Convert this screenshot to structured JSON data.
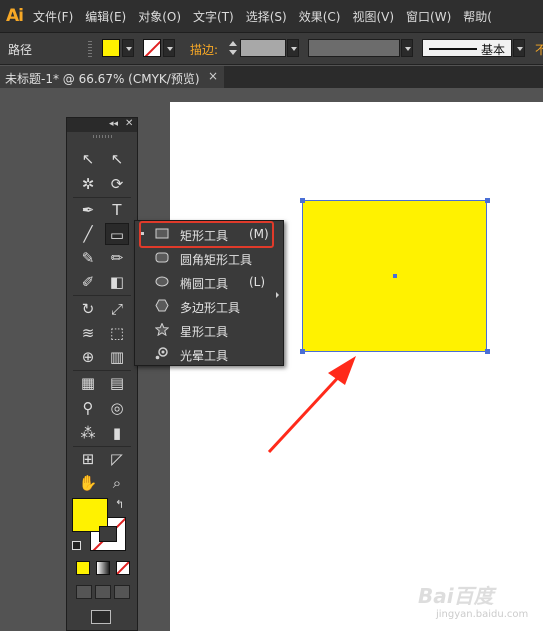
{
  "app": {
    "logo": "Ai"
  },
  "menu": [
    "文件(F)",
    "编辑(E)",
    "对象(O)",
    "文字(T)",
    "选择(S)",
    "效果(C)",
    "视图(V)",
    "窗口(W)",
    "帮助("
  ],
  "control_bar": {
    "path_label": "路径",
    "fill_color": "#fff200",
    "stroke_label": "描边:",
    "profile_label": "基本",
    "clipped_label": "不"
  },
  "document_tab": {
    "title": "未标题-1* @ 66.67% (CMYK/预览)",
    "close": "×"
  },
  "tools_panel": {
    "collapse": "◂◂",
    "close": "✕",
    "tools": [
      {
        "name": "selection-tool-icon",
        "glyph": "↖"
      },
      {
        "name": "direct-selection-tool-icon",
        "glyph": "↖"
      },
      {
        "name": "magic-wand-tool-icon",
        "glyph": "✲"
      },
      {
        "name": "lasso-tool-icon",
        "glyph": "⟳"
      },
      {
        "name": "pen-tool-icon",
        "glyph": "✒"
      },
      {
        "name": "type-tool-icon",
        "glyph": "T"
      },
      {
        "name": "line-tool-icon",
        "glyph": "╱"
      },
      {
        "name": "rectangle-tool-icon",
        "glyph": "▭"
      },
      {
        "name": "paintbrush-tool-icon",
        "glyph": "✎"
      },
      {
        "name": "pencil-tool-icon",
        "glyph": "✏"
      },
      {
        "name": "blob-brush-tool-icon",
        "glyph": "✐"
      },
      {
        "name": "eraser-tool-icon",
        "glyph": "◧"
      },
      {
        "name": "rotate-tool-icon",
        "glyph": "↻"
      },
      {
        "name": "scale-tool-icon",
        "glyph": "⤢"
      },
      {
        "name": "width-tool-icon",
        "glyph": "≋"
      },
      {
        "name": "free-transform-tool-icon",
        "glyph": "⬚"
      },
      {
        "name": "shape-builder-tool-icon",
        "glyph": "⊕"
      },
      {
        "name": "graph-tool-icon",
        "glyph": "▥"
      },
      {
        "name": "mesh-tool-icon",
        "glyph": "▦"
      },
      {
        "name": "gradient-tool-icon",
        "glyph": "▤"
      },
      {
        "name": "eyedropper-tool-icon",
        "glyph": "⚲"
      },
      {
        "name": "blend-tool-icon",
        "glyph": "◎"
      },
      {
        "name": "symbol-sprayer-tool-icon",
        "glyph": "⁂"
      },
      {
        "name": "column-graph-tool-icon",
        "glyph": "▮"
      },
      {
        "name": "artboard-tool-icon",
        "glyph": "⊞"
      },
      {
        "name": "slice-tool-icon",
        "glyph": "◸"
      },
      {
        "name": "hand-tool-icon",
        "glyph": "✋"
      },
      {
        "name": "zoom-tool-icon",
        "glyph": "⌕"
      }
    ],
    "swap_glyph": "↰"
  },
  "flyout": {
    "items": [
      {
        "label": "矩形工具",
        "shortcut": "(M)"
      },
      {
        "label": "圆角矩形工具",
        "shortcut": ""
      },
      {
        "label": "椭圆工具",
        "shortcut": "(L)"
      },
      {
        "label": "多边形工具",
        "shortcut": ""
      },
      {
        "label": "星形工具",
        "shortcut": ""
      },
      {
        "label": "光晕工具",
        "shortcut": ""
      }
    ]
  },
  "canvas": {
    "shape_fill": "#fff200",
    "selection_color": "#4a6fd6"
  },
  "annotation": {
    "arrow_color": "#ff2a1a",
    "highlight_color": "#e03a2a"
  },
  "watermark": {
    "text": "Bai百度",
    "sub": "jingyan.baidu.com"
  }
}
